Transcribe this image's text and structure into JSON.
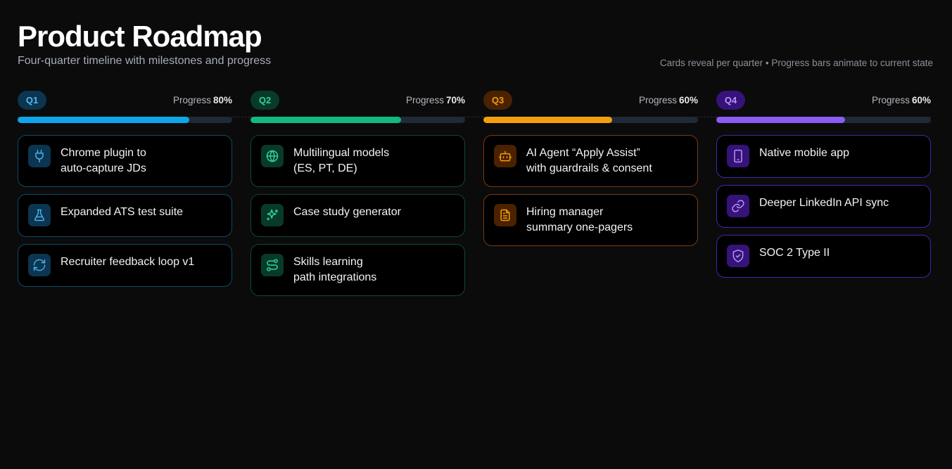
{
  "header": {
    "title": "Product Roadmap",
    "subtitle": "Four-quarter timeline with milestones and progress",
    "hint": "Cards reveal per quarter • Progress bars animate to current state"
  },
  "progress_word": "Progress",
  "quarters": [
    {
      "label": "Q1",
      "progress": 80,
      "progress_text": "80%",
      "color": "#0ea5e9",
      "cards": [
        {
          "icon": "plug-icon",
          "lines": [
            "Chrome plugin to",
            "auto-capture JDs"
          ]
        },
        {
          "icon": "flask-icon",
          "lines": [
            "Expanded ATS test suite"
          ]
        },
        {
          "icon": "refresh-icon",
          "lines": [
            "Recruiter feedback loop v1"
          ]
        }
      ]
    },
    {
      "label": "Q2",
      "progress": 70,
      "progress_text": "70%",
      "color": "#10b981",
      "cards": [
        {
          "icon": "globe-icon",
          "lines": [
            "Multilingual models",
            "(ES, PT, DE)"
          ]
        },
        {
          "icon": "sparkles-icon",
          "lines": [
            "Case study generator"
          ]
        },
        {
          "icon": "route-icon",
          "lines": [
            "Skills learning",
            "path integrations"
          ]
        }
      ]
    },
    {
      "label": "Q3",
      "progress": 60,
      "progress_text": "60%",
      "color": "#f59e0b",
      "cards": [
        {
          "icon": "bot-icon",
          "lines": [
            "AI Agent “Apply Assist”",
            "with guardrails & consent"
          ]
        },
        {
          "icon": "document-icon",
          "lines": [
            "Hiring manager",
            "summary one-pagers"
          ]
        }
      ]
    },
    {
      "label": "Q4",
      "progress": 60,
      "progress_text": "60%",
      "color": "#8b5cf6",
      "cards": [
        {
          "icon": "smartphone-icon",
          "lines": [
            "Native mobile app"
          ]
        },
        {
          "icon": "link-icon",
          "lines": [
            "Deeper LinkedIn API sync"
          ]
        },
        {
          "icon": "shield-check-icon",
          "lines": [
            "SOC 2 Type II"
          ]
        }
      ]
    }
  ]
}
